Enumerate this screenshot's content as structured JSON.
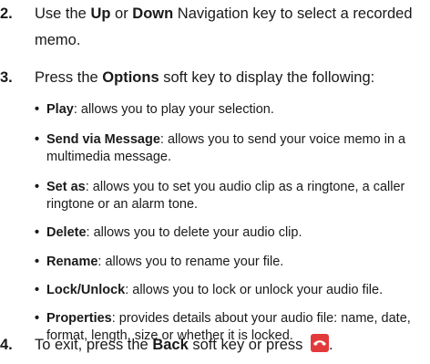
{
  "steps": [
    {
      "number": "2.",
      "parts": [
        "Use the ",
        "Up",
        " or ",
        "Down",
        " Navigation key to select a recorded memo."
      ]
    },
    {
      "number": "3.",
      "parts": [
        "Press the ",
        "Options",
        " soft key to display the following:"
      ]
    },
    {
      "number": "4.",
      "parts": [
        "To exit, press the ",
        "Back",
        " soft key or press ",
        "."
      ]
    }
  ],
  "options": [
    {
      "term": "Play",
      "description": ": allows you to play your selection."
    },
    {
      "term": "Send via Message",
      "description": ": allows you to send your voice memo in a multimedia message."
    },
    {
      "term": "Set as",
      "description": ": allows you to set you audio clip as a ringtone, a caller ringtone or an alarm tone."
    },
    {
      "term": "Delete",
      "description": ": allows you to delete your audio clip."
    },
    {
      "term": "Rename",
      "description": ": allows you to rename your file."
    },
    {
      "term": "Lock/Unlock",
      "description": ": allows you to lock or unlock your audio file."
    },
    {
      "term": "Properties",
      "description": ": provides details about your audio file: name, date, format, length, size or whether it is locked."
    }
  ],
  "bullet_char": "•",
  "icons": {
    "end_key": "end-call-key-icon",
    "end_key_color": "#e23a3a"
  }
}
